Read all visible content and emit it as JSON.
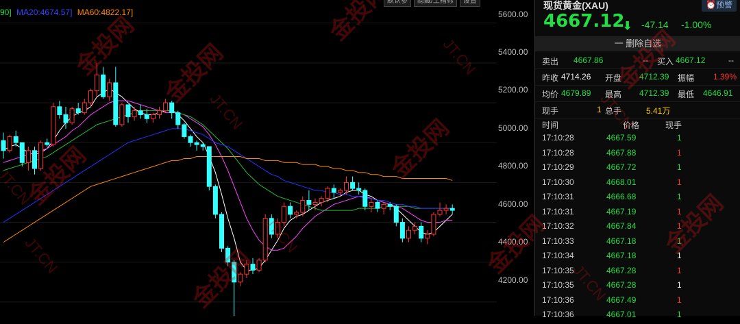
{
  "legend": {
    "ma_prefix": "90]",
    "ma20": "MA20:4674.57]",
    "ma60": "MA60:4822.17]",
    "colors": {
      "ma_prefix": "#22dd44",
      "ma20": "#2233ff",
      "ma60": "#ff8800"
    }
  },
  "toolbar": {
    "params_label": "默认参",
    "overlay_label": "隐藏/上指标",
    "settings_label": "设置"
  },
  "chart_data": {
    "type": "candlestick",
    "y_ticks": [
      "5600.00",
      "5400.00",
      "5200.00",
      "5000.00",
      "4800.00",
      "4600.00",
      "4400.00",
      "4200.00"
    ],
    "ylim": [
      4100,
      5640
    ],
    "min_label": "4097.99",
    "candles": [
      [
        5010,
        5050,
        4920,
        4960
      ],
      [
        4960,
        5040,
        4950,
        5030
      ],
      [
        5030,
        5060,
        4980,
        5000
      ],
      [
        5000,
        5000,
        4880,
        4900
      ],
      [
        4900,
        4980,
        4860,
        4960
      ],
      [
        4960,
        4980,
        4840,
        4870
      ],
      [
        4870,
        5010,
        4860,
        5000
      ],
      [
        5000,
        5020,
        4980,
        4990
      ],
      [
        4990,
        5200,
        4980,
        5180
      ],
      [
        5180,
        5210,
        5120,
        5140
      ],
      [
        5140,
        5180,
        5070,
        5100
      ],
      [
        5100,
        5180,
        5090,
        5170
      ],
      [
        5170,
        5200,
        5140,
        5150
      ],
      [
        5150,
        5220,
        5140,
        5200
      ],
      [
        5200,
        5270,
        5180,
        5260
      ],
      [
        5260,
        5400,
        5230,
        5340
      ],
      [
        5340,
        5380,
        5220,
        5230
      ],
      [
        5230,
        5320,
        5210,
        5300
      ],
      [
        5300,
        5380,
        5080,
        5090
      ],
      [
        5090,
        5200,
        5080,
        5190
      ],
      [
        5190,
        5190,
        5100,
        5130
      ],
      [
        5130,
        5180,
        5110,
        5160
      ],
      [
        5160,
        5190,
        5120,
        5140
      ],
      [
        5140,
        5170,
        5100,
        5120
      ],
      [
        5120,
        5150,
        5100,
        5140
      ],
      [
        5140,
        5180,
        5120,
        5160
      ],
      [
        5160,
        5220,
        5150,
        5200
      ],
      [
        5200,
        5210,
        5120,
        5150
      ],
      [
        5150,
        5160,
        5070,
        5090
      ],
      [
        5090,
        5100,
        5020,
        5030
      ],
      [
        5030,
        5040,
        4980,
        5000
      ],
      [
        5000,
        5010,
        4960,
        4990
      ],
      [
        4990,
        5000,
        4960,
        4980
      ],
      [
        4980,
        4980,
        4760,
        4780
      ],
      [
        4780,
        4790,
        4620,
        4640
      ],
      [
        4640,
        4650,
        4450,
        4470
      ],
      [
        4470,
        4480,
        4380,
        4400
      ],
      [
        4400,
        4410,
        4098,
        4300
      ],
      [
        4300,
        4350,
        4280,
        4340
      ],
      [
        4340,
        4410,
        4320,
        4390
      ],
      [
        4390,
        4420,
        4340,
        4360
      ],
      [
        4360,
        4420,
        4350,
        4410
      ],
      [
        4410,
        4640,
        4400,
        4620
      ],
      [
        4620,
        4640,
        4520,
        4540
      ],
      [
        4540,
        4620,
        4520,
        4600
      ],
      [
        4600,
        4700,
        4580,
        4680
      ],
      [
        4680,
        4700,
        4620,
        4640
      ],
      [
        4640,
        4660,
        4620,
        4650
      ],
      [
        4650,
        4730,
        4630,
        4710
      ],
      [
        4710,
        4760,
        4660,
        4690
      ],
      [
        4690,
        4720,
        4660,
        4700
      ],
      [
        4700,
        4730,
        4680,
        4720
      ],
      [
        4720,
        4780,
        4700,
        4770
      ],
      [
        4770,
        4790,
        4720,
        4750
      ],
      [
        4750,
        4770,
        4730,
        4760
      ],
      [
        4760,
        4830,
        4740,
        4800
      ],
      [
        4800,
        4830,
        4760,
        4770
      ],
      [
        4770,
        4800,
        4740,
        4760
      ],
      [
        4760,
        4770,
        4660,
        4680
      ],
      [
        4680,
        4720,
        4650,
        4700
      ],
      [
        4700,
        4710,
        4650,
        4670
      ],
      [
        4670,
        4700,
        4640,
        4690
      ],
      [
        4690,
        4700,
        4660,
        4680
      ],
      [
        4680,
        4690,
        4580,
        4600
      ],
      [
        4600,
        4620,
        4500,
        4520
      ],
      [
        4520,
        4580,
        4500,
        4560
      ],
      [
        4560,
        4600,
        4540,
        4580
      ],
      [
        4580,
        4600,
        4500,
        4520
      ],
      [
        4520,
        4560,
        4490,
        4540
      ],
      [
        4540,
        4650,
        4530,
        4640
      ],
      [
        4640,
        4700,
        4630,
        4660
      ],
      [
        4660,
        4690,
        4640,
        4670
      ],
      [
        4670,
        4690,
        4640,
        4660
      ]
    ],
    "ma_lines": [
      {
        "name": "MA5",
        "color": "#ffffff",
        "values": [
          4960,
          4980,
          4990,
          4970,
          4950,
          4940,
          4950,
          4970,
          5010,
          5060,
          5100,
          5130,
          5150,
          5160,
          5180,
          5230,
          5250,
          5270,
          5250,
          5230,
          5200,
          5170,
          5150,
          5140,
          5140,
          5150,
          5160,
          5160,
          5140,
          5110,
          5070,
          5030,
          5000,
          4930,
          4850,
          4740,
          4620,
          4520,
          4400,
          4360,
          4360,
          4370,
          4410,
          4460,
          4510,
          4570,
          4610,
          4630,
          4640,
          4660,
          4680,
          4700,
          4710,
          4720,
          4730,
          4750,
          4760,
          4760,
          4740,
          4730,
          4710,
          4700,
          4690,
          4670,
          4640,
          4610,
          4580,
          4550,
          4540,
          4550,
          4580,
          4610,
          4640
        ]
      },
      {
        "name": "MA10",
        "color": "#ff44ff",
        "values": [
          4900,
          4910,
          4920,
          4930,
          4940,
          4950,
          4960,
          4970,
          4990,
          5010,
          5030,
          5060,
          5080,
          5110,
          5140,
          5160,
          5180,
          5200,
          5210,
          5210,
          5210,
          5200,
          5190,
          5180,
          5170,
          5160,
          5150,
          5150,
          5150,
          5140,
          5120,
          5100,
          5080,
          5040,
          4990,
          4930,
          4860,
          4780,
          4700,
          4620,
          4560,
          4510,
          4480,
          4460,
          4460,
          4470,
          4500,
          4530,
          4570,
          4600,
          4630,
          4650,
          4670,
          4690,
          4700,
          4710,
          4720,
          4730,
          4730,
          4720,
          4710,
          4700,
          4690,
          4680,
          4670,
          4650,
          4630,
          4610,
          4600,
          4600,
          4600,
          4610,
          4610
        ]
      },
      {
        "name": "MA20",
        "color": "#22bb33",
        "values": [
          4860,
          4870,
          4880,
          4890,
          4900,
          4910,
          4920,
          4930,
          4950,
          4970,
          4990,
          5010,
          5030,
          5050,
          5070,
          5090,
          5100,
          5110,
          5120,
          5130,
          5140,
          5150,
          5160,
          5160,
          5160,
          5160,
          5160,
          5160,
          5150,
          5140,
          5130,
          5110,
          5090,
          5060,
          5030,
          5000,
          4970,
          4930,
          4890,
          4850,
          4820,
          4790,
          4770,
          4750,
          4730,
          4720,
          4710,
          4700,
          4690,
          4680,
          4670,
          4660,
          4660,
          4660,
          4660,
          4660,
          4660,
          4670,
          4670,
          4670,
          4670,
          4680,
          4680,
          4680,
          4680,
          4680,
          4670,
          4670,
          4670,
          4670,
          4670,
          4670,
          4670
        ]
      },
      {
        "name": "MA40",
        "color": "#2233ff",
        "values": [
          4600,
          4620,
          4640,
          4660,
          4680,
          4700,
          4720,
          4740,
          4760,
          4780,
          4800,
          4820,
          4840,
          4860,
          4880,
          4900,
          4920,
          4940,
          4960,
          4980,
          5000,
          5010,
          5020,
          5030,
          5040,
          5050,
          5060,
          5070,
          5070,
          5070,
          5060,
          5050,
          5040,
          5020,
          5000,
          4990,
          4980,
          4960,
          4940,
          4920,
          4900,
          4880,
          4860,
          4840,
          4830,
          4810,
          4800,
          4790,
          4780,
          4770,
          4760,
          4760,
          4750,
          4750,
          4740,
          4740,
          4730,
          4730,
          4720,
          4720,
          4710,
          4710,
          4700,
          4690,
          4690,
          4680,
          4680,
          4670,
          4670,
          4670,
          4670,
          4670,
          4670
        ]
      },
      {
        "name": "MA60",
        "color": "#ff8800",
        "values": [
          4500,
          4520,
          4540,
          4560,
          4580,
          4600,
          4620,
          4640,
          4660,
          4680,
          4700,
          4720,
          4740,
          4760,
          4780,
          4790,
          4800,
          4810,
          4820,
          4830,
          4840,
          4850,
          4860,
          4870,
          4880,
          4890,
          4900,
          4910,
          4910,
          4920,
          4920,
          4930,
          4930,
          4930,
          4930,
          4930,
          4930,
          4930,
          4930,
          4920,
          4920,
          4920,
          4910,
          4910,
          4910,
          4900,
          4900,
          4900,
          4890,
          4890,
          4890,
          4880,
          4880,
          4870,
          4870,
          4860,
          4860,
          4850,
          4850,
          4840,
          4840,
          4830,
          4830,
          4830,
          4820,
          4820,
          4820,
          4820,
          4820,
          4820,
          4820,
          4820,
          4810
        ]
      }
    ]
  },
  "panel": {
    "title": "现货黄金(XAU)",
    "alert_label": "⏰预警",
    "price": "4667.12",
    "change": "-47.14",
    "change_pct": "-1.00%",
    "delete_label": "一 删除自选",
    "sell_label": "卖出",
    "sell_price": "4667.86",
    "sell_vol": "--",
    "buy_label": "买入",
    "buy_price": "4667.12",
    "buy_vol": "--",
    "prev_close_label": "昨收",
    "prev_close": "4714.26",
    "open_label": "开盘",
    "open": "4712.39",
    "amplitude_label": "振幅",
    "amplitude": "1.39%",
    "avg_label": "均价",
    "avg": "4679.89",
    "high_label": "最高",
    "high": "4712.39",
    "low_label": "最低",
    "low": "4646.91",
    "cur_vol_label": "现手",
    "cur_vol": "1",
    "total_vol_label": "总手",
    "total_vol": "5.41万",
    "col_time": "时间",
    "col_price": "价格",
    "col_vol": "现手",
    "ticks": [
      {
        "time": "17:10:28",
        "price": "4667.59",
        "vol": "1",
        "vc": "g"
      },
      {
        "time": "17:10:28",
        "price": "4667.88",
        "vol": "1",
        "vc": "r"
      },
      {
        "time": "17:10:29",
        "price": "4667.72",
        "vol": "1",
        "vc": "g"
      },
      {
        "time": "17:10:30",
        "price": "4668.01",
        "vol": "1",
        "vc": "r"
      },
      {
        "time": "17:10:31",
        "price": "4666.68",
        "vol": "1",
        "vc": "g"
      },
      {
        "time": "17:10:31",
        "price": "4667.19",
        "vol": "1",
        "vc": "r"
      },
      {
        "time": "17:10:32",
        "price": "4667.84",
        "vol": "1",
        "vc": "r"
      },
      {
        "time": "17:10:33",
        "price": "4667.18",
        "vol": "1",
        "vc": "g"
      },
      {
        "time": "17:10:34",
        "price": "4667.18",
        "vol": "1",
        "vc": "w"
      },
      {
        "time": "17:10:35",
        "price": "4667.28",
        "vol": "1",
        "vc": "r"
      },
      {
        "time": "17:10:35",
        "price": "4667.28",
        "vol": "1",
        "vc": "w"
      },
      {
        "time": "17:10:36",
        "price": "4667.49",
        "vol": "1",
        "vc": "r"
      },
      {
        "time": "17:10:36",
        "price": "4667.01",
        "vol": "1",
        "vc": "g"
      }
    ]
  },
  "watermark": {
    "text_cn": "金投网",
    "text_en": "JT.CN"
  }
}
